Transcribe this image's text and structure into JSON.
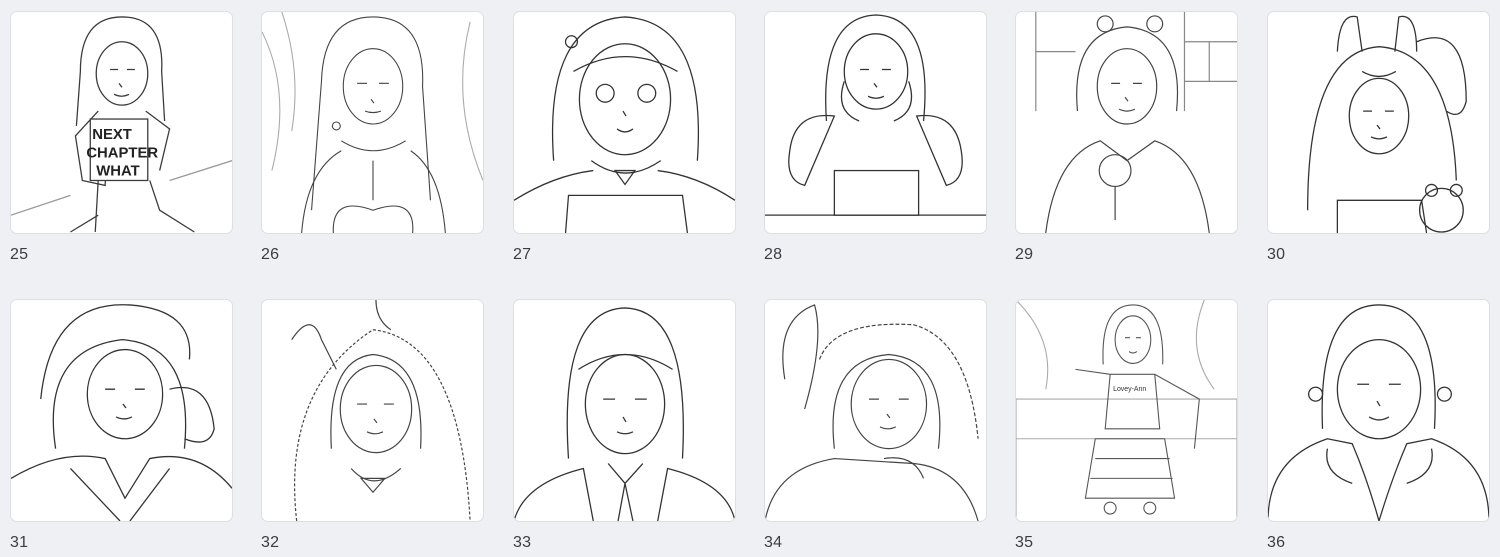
{
  "gallery": {
    "items": [
      {
        "number": "25",
        "shirt_text": [
          "NEXT",
          "CHAPTER",
          "WHAT"
        ]
      },
      {
        "number": "26"
      },
      {
        "number": "27"
      },
      {
        "number": "28"
      },
      {
        "number": "29"
      },
      {
        "number": "30"
      },
      {
        "number": "31"
      },
      {
        "number": "32"
      },
      {
        "number": "33"
      },
      {
        "number": "34"
      },
      {
        "number": "35",
        "shirt_text": [
          "Lovey-Ann"
        ]
      },
      {
        "number": "36"
      }
    ]
  },
  "colors": {
    "background": "#eef0f3",
    "card": "#ffffff",
    "line_art": "#3b3b3b"
  }
}
